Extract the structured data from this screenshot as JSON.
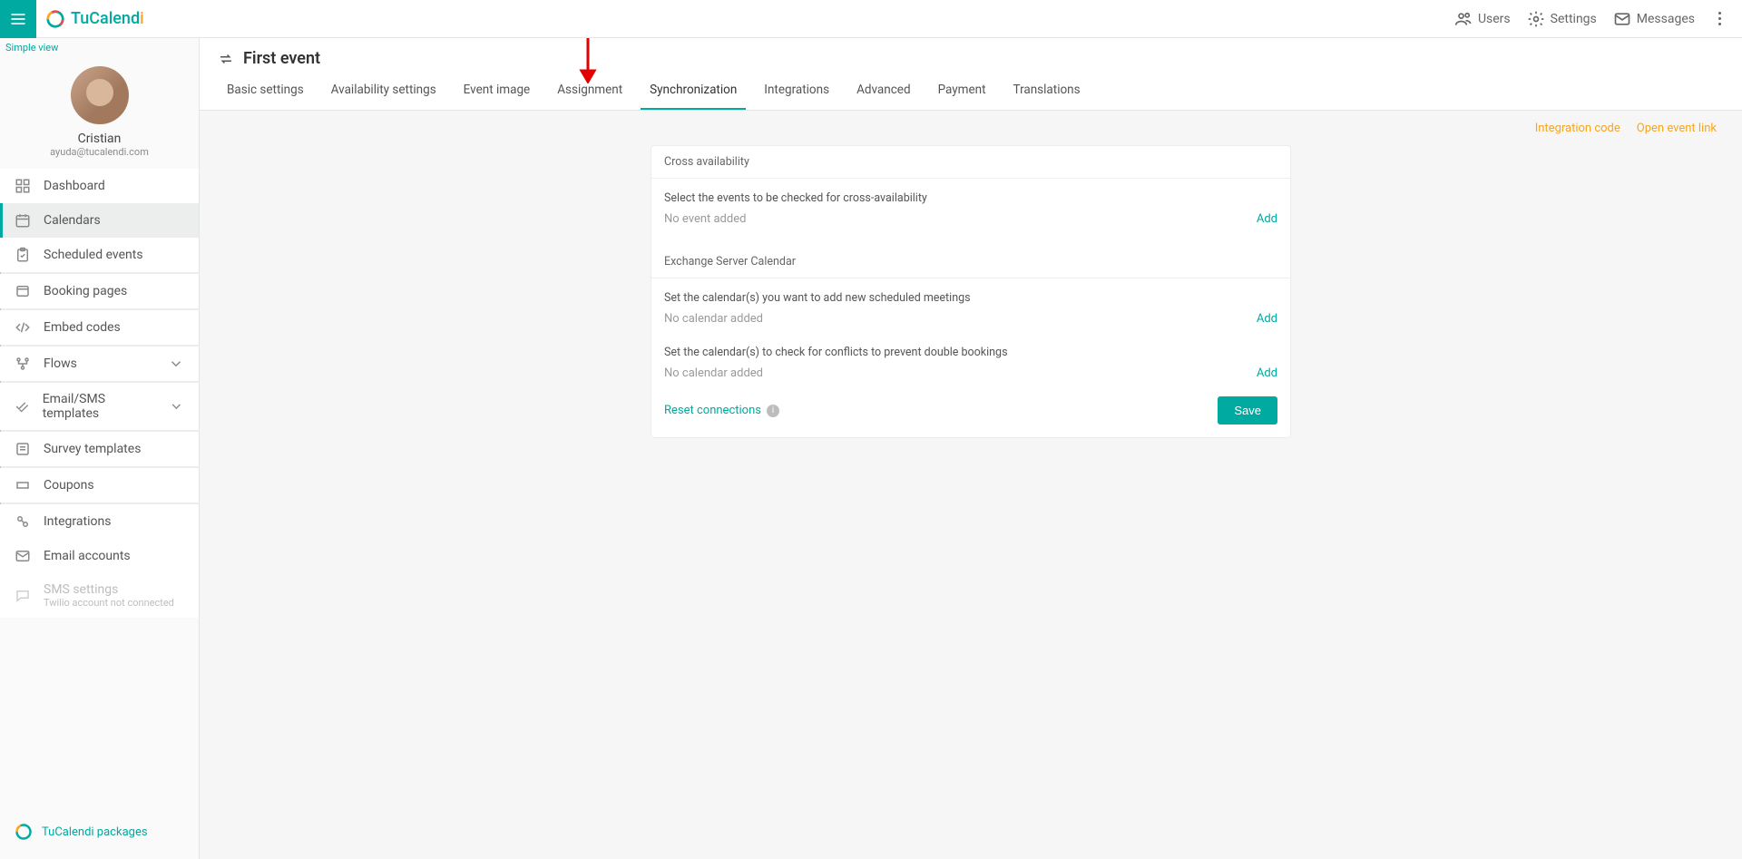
{
  "brand": {
    "part1": "TuCalend",
    "part2": "i"
  },
  "topbar": {
    "users": "Users",
    "settings": "Settings",
    "messages": "Messages"
  },
  "sidebar": {
    "simple_view": "Simple view",
    "profile": {
      "name": "Cristian",
      "email": "ayuda@tucalendi.com"
    },
    "items": [
      {
        "label": "Dashboard"
      },
      {
        "label": "Calendars"
      },
      {
        "label": "Scheduled events"
      },
      {
        "label": "Booking pages"
      },
      {
        "label": "Embed codes"
      },
      {
        "label": "Flows"
      },
      {
        "label": "Email/SMS templates"
      },
      {
        "label": "Survey templates"
      },
      {
        "label": "Coupons"
      },
      {
        "label": "Integrations"
      },
      {
        "label": "Email accounts"
      },
      {
        "label": "SMS settings",
        "sub": "Twilio account not connected"
      }
    ],
    "footer": "TuCalendi packages"
  },
  "page": {
    "title": "First event",
    "tabs": [
      "Basic settings",
      "Availability settings",
      "Event image",
      "Assignment",
      "Synchronization",
      "Integrations",
      "Advanced",
      "Payment",
      "Translations"
    ],
    "active_tab_index": 4,
    "links": {
      "integration_code": "Integration code",
      "open_event": "Open event link"
    }
  },
  "panel": {
    "cross_availability": {
      "title": "Cross availability",
      "helper": "Select the events to be checked for cross-availability",
      "empty": "No event added",
      "add": "Add"
    },
    "exchange": {
      "title": "Exchange Server Calendar",
      "helper1": "Set the calendar(s) you want to add new scheduled meetings",
      "empty1": "No calendar added",
      "helper2": "Set the calendar(s) to check for conflicts to prevent double bookings",
      "empty2": "No calendar added",
      "add": "Add"
    },
    "footer": {
      "reset": "Reset connections",
      "save": "Save"
    }
  },
  "colors": {
    "accent": "#00aaa0",
    "warn": "#f5a623"
  }
}
